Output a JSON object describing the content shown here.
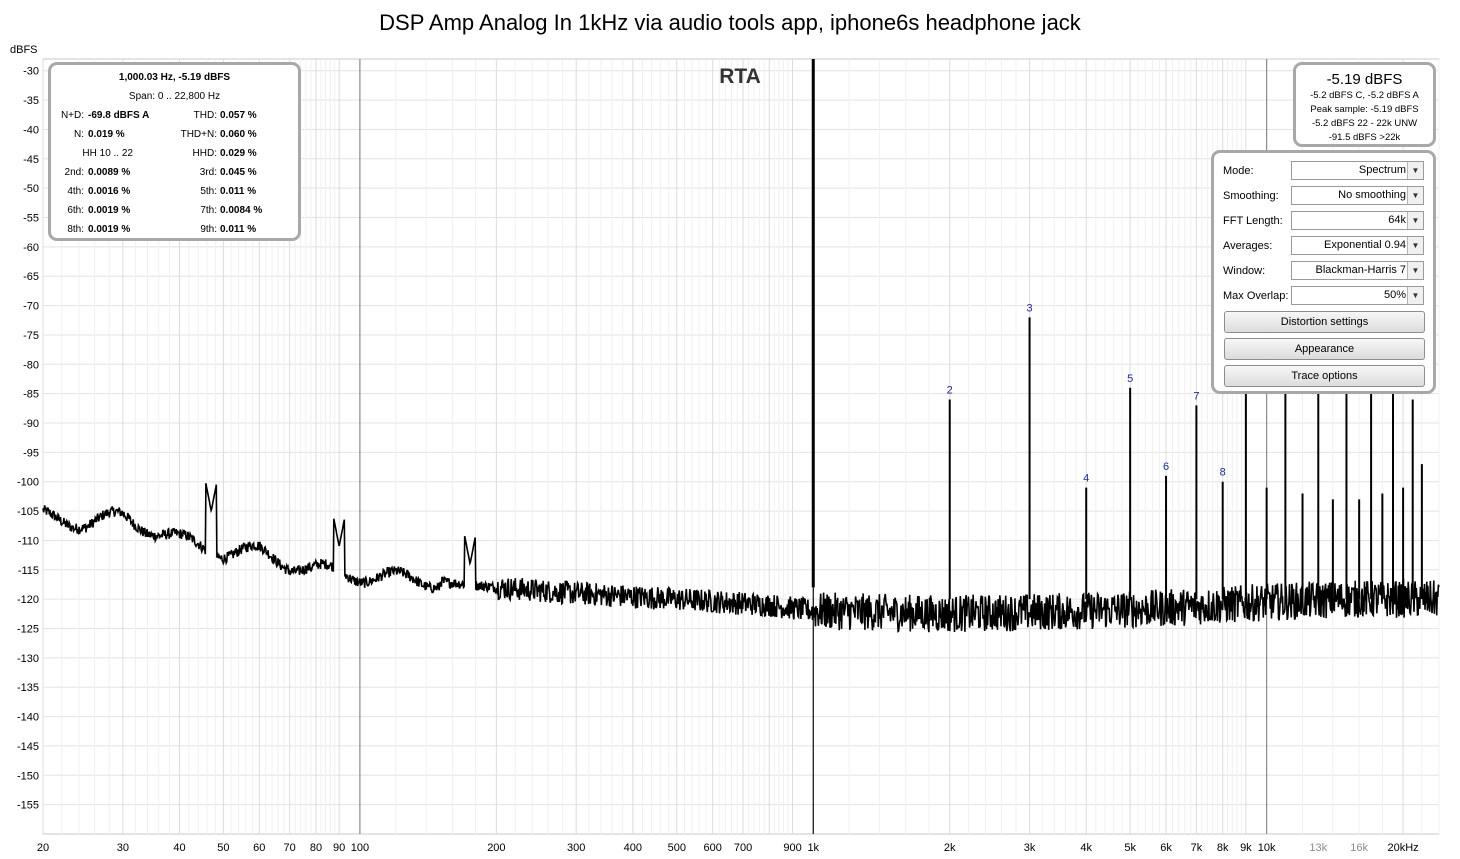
{
  "chart_data": {
    "type": "line",
    "title": "DSP Amp Analog In 1kHz via audio tools app, iphone6s headphone jack",
    "ylabel": "dBFS",
    "xlabel": "",
    "plot_label": "RTA",
    "x_scale": "log",
    "xlim": [
      20,
      24000
    ],
    "ylim": [
      -160,
      -28
    ],
    "y_ticks": [
      -30,
      -35,
      -40,
      -45,
      -50,
      -55,
      -60,
      -65,
      -70,
      -75,
      -80,
      -85,
      -90,
      -95,
      -100,
      -105,
      -110,
      -115,
      -120,
      -125,
      -130,
      -135,
      -140,
      -145,
      -150,
      -155
    ],
    "x_ticks": [
      {
        "value": 20,
        "label": "20"
      },
      {
        "value": 30,
        "label": "30"
      },
      {
        "value": 40,
        "label": "40"
      },
      {
        "value": 50,
        "label": "50"
      },
      {
        "value": 60,
        "label": "60"
      },
      {
        "value": 70,
        "label": "70"
      },
      {
        "value": 80,
        "label": "80"
      },
      {
        "value": 90,
        "label": "90"
      },
      {
        "value": 100,
        "label": "100"
      },
      {
        "value": 200,
        "label": "200"
      },
      {
        "value": 300,
        "label": "300"
      },
      {
        "value": 400,
        "label": "400"
      },
      {
        "value": 500,
        "label": "500"
      },
      {
        "value": 600,
        "label": "600"
      },
      {
        "value": 700,
        "label": "700"
      },
      {
        "value": 900,
        "label": "900"
      },
      {
        "value": 1000,
        "label": "1k"
      },
      {
        "value": 2000,
        "label": "2k"
      },
      {
        "value": 3000,
        "label": "3k"
      },
      {
        "value": 4000,
        "label": "4k"
      },
      {
        "value": 5000,
        "label": "5k"
      },
      {
        "value": 6000,
        "label": "6k"
      },
      {
        "value": 7000,
        "label": "7k"
      },
      {
        "value": 8000,
        "label": "8k"
      },
      {
        "value": 9000,
        "label": "9k"
      },
      {
        "value": 10000,
        "label": "10k"
      },
      {
        "value": 13000,
        "label": "13k"
      },
      {
        "value": 16000,
        "label": "16k"
      },
      {
        "value": 20000,
        "label": "20kHz"
      }
    ],
    "series": [
      {
        "color": "#000000",
        "noise_floor": [
          [
            20,
            -106
          ],
          [
            25,
            -107
          ],
          [
            30,
            -106
          ],
          [
            40,
            -110
          ],
          [
            50,
            -112
          ],
          [
            60,
            -112
          ],
          [
            70,
            -114
          ],
          [
            80,
            -115
          ],
          [
            100,
            -116
          ],
          [
            150,
            -117
          ],
          [
            200,
            -118
          ],
          [
            300,
            -119
          ],
          [
            500,
            -120
          ],
          [
            800,
            -121
          ],
          [
            1000,
            -122
          ],
          [
            2000,
            -122.5
          ],
          [
            4000,
            -122
          ],
          [
            6000,
            -121.5
          ],
          [
            8000,
            -121
          ],
          [
            10000,
            -120.5
          ],
          [
            15000,
            -120
          ],
          [
            20000,
            -120
          ],
          [
            24000,
            -120
          ]
        ],
        "spurs": [
          [
            47,
            -105
          ],
          [
            90,
            -111
          ],
          [
            175,
            -114
          ],
          [
            1000,
            -5.19
          ]
        ],
        "harmonics": [
          {
            "label": "2",
            "freq": 2000,
            "level": -86
          },
          {
            "label": "3",
            "freq": 3000,
            "level": -72
          },
          {
            "label": "4",
            "freq": 4000,
            "level": -101
          },
          {
            "label": "5",
            "freq": 5000,
            "level": -84
          },
          {
            "label": "6",
            "freq": 6000,
            "level": -99
          },
          {
            "label": "7",
            "freq": 7000,
            "level": -87
          },
          {
            "label": "8",
            "freq": 8000,
            "level": -100
          },
          {
            "label": "9",
            "freq": 9000,
            "level": -85
          }
        ],
        "upper_spurs": [
          [
            10000,
            -101
          ],
          [
            11000,
            -83
          ],
          [
            12000,
            -102
          ],
          [
            13000,
            -83
          ],
          [
            14000,
            -103
          ],
          [
            15000,
            -83
          ],
          [
            16000,
            -103
          ],
          [
            17000,
            -84
          ],
          [
            18000,
            -102
          ],
          [
            19000,
            -85
          ],
          [
            20000,
            -101
          ],
          [
            21000,
            -86
          ],
          [
            22000,
            -97
          ]
        ]
      }
    ]
  },
  "stats": {
    "fundamental": "1,000.03 Hz, -5.19 dBFS",
    "span": "Span: 0 .. 22,800 Hz",
    "nd_label": "N+D:",
    "nd_value": "-69.8 dBFS A",
    "thd_label": "THD:",
    "thd_value": "0.057 %",
    "n_label": "N:",
    "n_value": "0.019 %",
    "thdn_label": "THD+N:",
    "thdn_value": "0.060 %",
    "hh_label": "HH 10 .. 22",
    "hhd_label": "HHD:",
    "hhd_value": "0.029 %",
    "h2_label": "2nd:",
    "h2_value": "0.0089 %",
    "h3_label": "3rd:",
    "h3_value": "0.045 %",
    "h4_label": "4th:",
    "h4_value": "0.0016 %",
    "h5_label": "5th:",
    "h5_value": "0.011 %",
    "h6_label": "6th:",
    "h6_value": "0.0019 %",
    "h7_label": "7th:",
    "h7_value": "0.0084 %",
    "h8_label": "8th:",
    "h8_value": "0.0019 %",
    "h9_label": "9th:",
    "h9_value": "0.011 %"
  },
  "level": {
    "main": "-5.19 dBFS",
    "line1": "-5.2 dBFS C, -5.2 dBFS A",
    "line2": "Peak sample: -5.19 dBFS",
    "line3": "-5.2 dBFS 22 - 22k UNW",
    "line4": "-91.5 dBFS >22k"
  },
  "controls": {
    "mode_label": "Mode:",
    "mode_value": "Spectrum",
    "smoothing_label": "Smoothing:",
    "smoothing_value": "No  smoothing",
    "fft_label": "FFT Length:",
    "fft_value": "64k",
    "averages_label": "Averages:",
    "averages_value": "Exponential 0.94",
    "window_label": "Window:",
    "window_value": "Blackman-Harris 7",
    "overlap_label": "Max Overlap:",
    "overlap_value": "50%",
    "distortion_button": "Distortion settings",
    "appearance_button": "Appearance",
    "trace_button": "Trace options"
  }
}
